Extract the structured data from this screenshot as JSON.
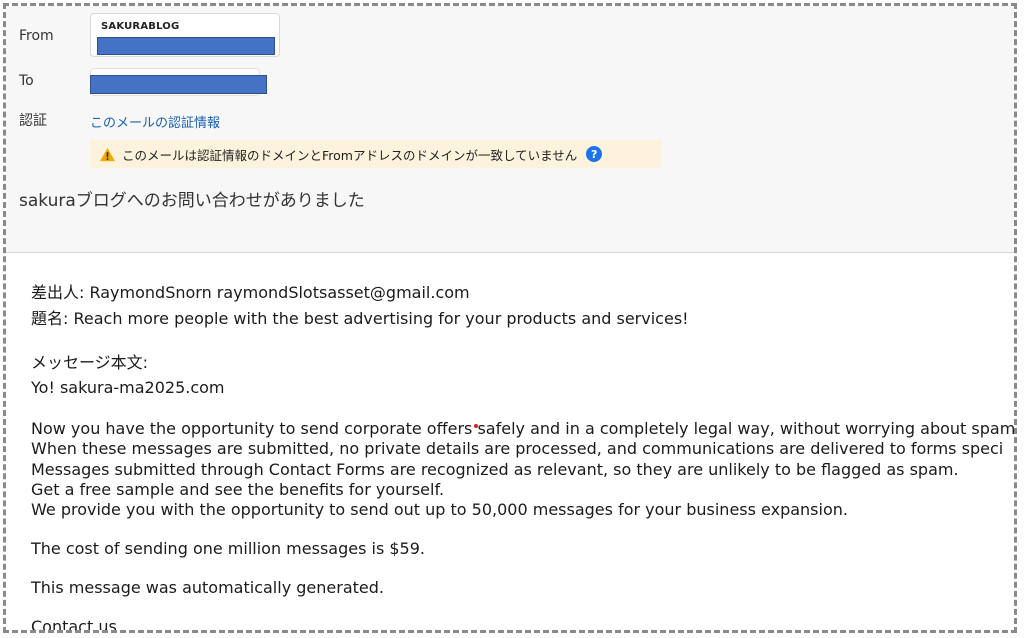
{
  "header": {
    "from_label": "From",
    "from_name": "SAKURABLOG",
    "to_label": "To",
    "auth_label": "認証",
    "auth_link": "このメールの認証情報",
    "warning_text": "このメールは認証情報のドメインとFromアドレスのドメインが一致していません",
    "help_icon": "?",
    "subject": "sakuraブログへのお問い合わせがありました"
  },
  "message": {
    "sender": "差出人: RaymondSnorn raymondSlotsasset@gmail.com",
    "title": "題名: Reach more people with the best advertising for your products and services!",
    "body_label": "メッセージ本文:",
    "greeting": "Yo! sakura-ma2025.com",
    "para1": [
      "Now you have the opportunity to send corporate offers safely and in a completely legal way, without worrying about spam",
      "When these messages are submitted, no private details are processed, and communications are delivered to forms speci",
      "Messages submitted through Contact Forms are recognized as relevant, so they are unlikely to be flagged as spam.",
      "Get a free sample and see the benefits for yourself.",
      "We provide you with the opportunity to send out up to 50,000 messages for your business expansion."
    ],
    "cost": "The cost of sending one million messages is $59.",
    "auto": "This message was automatically generated.",
    "contact": "Contact us."
  },
  "colors": {
    "redaction": "#4472c4",
    "link": "#1a5fb4",
    "warning_bg": "#fdf2dc",
    "help_icon": "#1a73e8"
  }
}
